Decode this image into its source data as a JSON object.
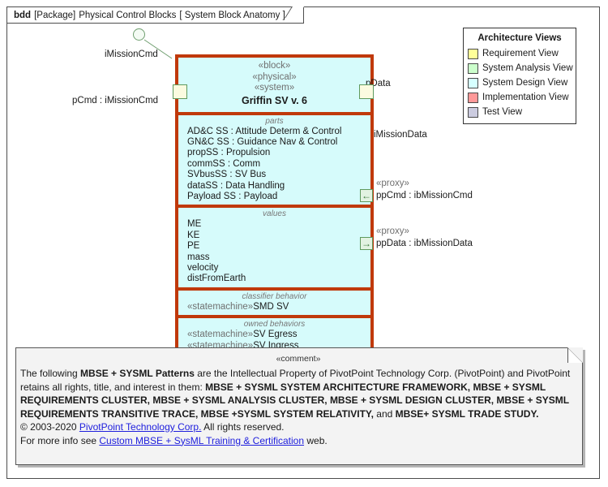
{
  "frame": {
    "kind": "bdd",
    "package_tag": "[Package]",
    "package_name": "Physical Control Blocks",
    "view_name": "[ System Block Anatomy ]"
  },
  "block": {
    "stereotypes": [
      "«block»",
      "«physical»",
      "«system»"
    ],
    "name": "Griffin SV v. 6",
    "fill_color": "#D6FBFB",
    "border_color": "#C0390B",
    "compartments": [
      {
        "title": "parts",
        "items": [
          "AD&C SS : Attitude Determ & Control",
          "GN&C SS : Guidance Nav & Control",
          "propSS : Propulsion",
          "commSS : Comm",
          "SVbusSS : SV Bus",
          "dataSS : Data Handling",
          "Payload SS : Payload"
        ]
      },
      {
        "title": "values",
        "items": [
          "ME",
          "KE",
          "PE",
          "mass",
          "velocity",
          "distFromEarth"
        ]
      },
      {
        "title": "classifier behavior",
        "items": [
          {
            "stereotype": "«statemachine»",
            "name": "SMD SV"
          }
        ]
      },
      {
        "title": "owned behaviors",
        "items": [
          {
            "stereotype": "«statemachine»",
            "name": "SV Egress"
          },
          {
            "stereotype": "«statemachine»",
            "name": "SV Ingress"
          }
        ]
      }
    ]
  },
  "ports": {
    "p_cmd": {
      "label": "pCmd : iMissionCmd",
      "interface": "iMissionCmd"
    },
    "p_data": {
      "label": "pData",
      "interface": "iMissionData"
    },
    "pp_cmd": {
      "stereotype": "«proxy»",
      "label": "ppCmd : ibMissionCmd",
      "direction": "in",
      "glyph": "←"
    },
    "pp_data": {
      "stereotype": "«proxy»",
      "label": "ppData : ibMissionData",
      "direction": "out",
      "glyph": "→"
    }
  },
  "legend": {
    "title": "Architecture Views",
    "rows": [
      {
        "label": "Requirement View",
        "color": "#FFFF99"
      },
      {
        "label": "System Analysis View",
        "color": "#CCFFCC"
      },
      {
        "label": "System Design View",
        "color": "#D6FFFF"
      },
      {
        "label": "Implementation View",
        "color": "#FF9999"
      },
      {
        "label": "Test View",
        "color": "#CCCCE0"
      }
    ]
  },
  "comment": {
    "stereotype": "«comment»",
    "line1_a": "The following ",
    "line1_b": "MBSE + SYSML Patterns",
    "line1_c": " are the Intellectual Property of PivotPoint Technology Corp. (PivotPoint) and PivotPoint",
    "line2_a": "retains all rights, title, and interest in them: ",
    "line2_b": "MBSE + SYSML SYSTEM ARCHITECTURE FRAMEWORK, MBSE + SYSML",
    "line3_b": "REQUIREMENTS CLUSTER, MBSE + SYSML ANALYSIS CLUSTER, MBSE + SYSML DESIGN CLUSTER, MBSE + SYSML",
    "line4_b": " REQUIREMENTS TRANSITIVE TRACE, MBSE +SYSML SYSTEM RELATIVITY,",
    "line4_c": " and ",
    "line4_d": "MBSE+ SYSML TRADE STUDY.",
    "line5_a": "© 2003-2020 ",
    "line5_link": "PivotPoint Technology Corp.",
    "line5_b": " All rights reserved.",
    "line6_a": "For more info see ",
    "line6_link": "Custom MBSE + SysML Training & Certification",
    "line6_b": " web."
  }
}
